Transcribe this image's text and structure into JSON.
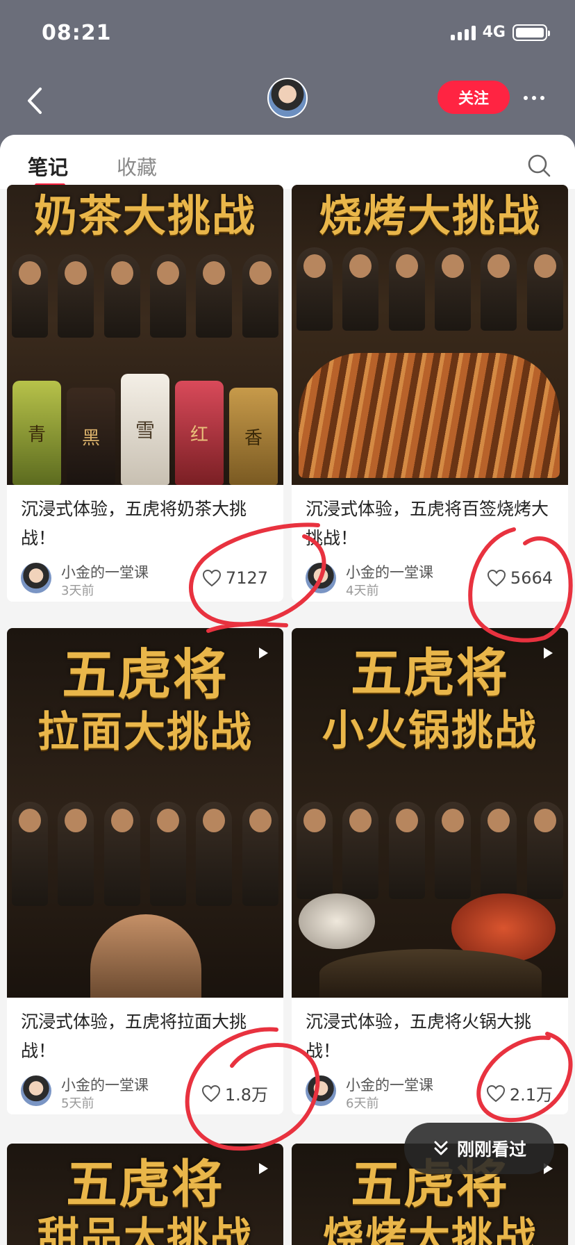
{
  "status_bar": {
    "time": "08:21",
    "network": "4G"
  },
  "header": {
    "follow_label": "关注"
  },
  "tabs": [
    {
      "label": "笔记",
      "active": true
    },
    {
      "label": "收藏",
      "active": false
    }
  ],
  "notes": [
    {
      "cover_title": "奶茶大挑战",
      "cover_labels": [
        "青",
        "黑",
        "雪",
        "红",
        "香"
      ],
      "title": "沉浸式体验，五虎将奶茶大挑战！",
      "author": "小金的一堂课",
      "time": "3天前",
      "likes": "7127",
      "video": false
    },
    {
      "cover_title": "烧烤大挑战",
      "title": "沉浸式体验，五虎将百签烧烤大挑战！",
      "author": "小金的一堂课",
      "time": "4天前",
      "likes": "5664",
      "video": false
    },
    {
      "cover_title_line1": "五虎将",
      "cover_title_line2": "拉面大挑战",
      "title": "沉浸式体验，五虎将拉面大挑战！",
      "author": "小金的一堂课",
      "time": "5天前",
      "likes": "1.8万",
      "video": true
    },
    {
      "cover_title_line1": "五虎将",
      "cover_title_line2": "小火锅挑战",
      "title": "沉浸式体验，五虎将火锅大挑战！",
      "author": "小金的一堂课",
      "time": "6天前",
      "likes": "2.1万",
      "video": true
    },
    {
      "cover_title_line1": "五虎将",
      "cover_title_line2": "甜品大挑战",
      "video": true
    },
    {
      "cover_title_line1": "五虎将",
      "cover_title_line2": "烧烤大挑战",
      "video": true
    }
  ],
  "recent_button": {
    "label": "刚刚看过"
  },
  "colors": {
    "accent": "#ff2442",
    "annotation": "#e8323f",
    "cover_gold": "#e9b64a"
  },
  "icons": [
    "back-icon",
    "search-icon",
    "more-icon",
    "heart-icon",
    "play-icon",
    "double-chevron-down-icon"
  ]
}
